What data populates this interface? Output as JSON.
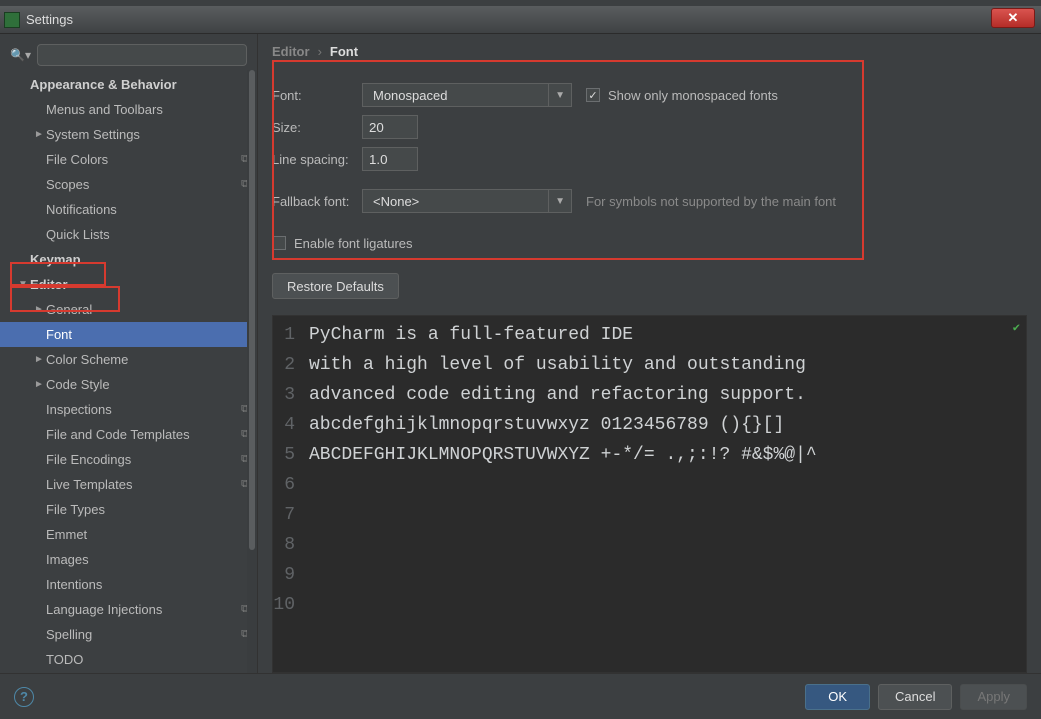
{
  "window": {
    "title": "Settings"
  },
  "breadcrumb": {
    "root": "Editor",
    "current": "Font"
  },
  "sidebar": {
    "search_placeholder": "",
    "items": [
      {
        "label": "Appearance & Behavior",
        "indent": 0,
        "bold": true,
        "arrow": ""
      },
      {
        "label": "Menus and Toolbars",
        "indent": 1,
        "arrow": ""
      },
      {
        "label": "System Settings",
        "indent": 1,
        "arrow": "►"
      },
      {
        "label": "File Colors",
        "indent": 1,
        "arrow": "",
        "copy": true
      },
      {
        "label": "Scopes",
        "indent": 1,
        "arrow": "",
        "copy": true
      },
      {
        "label": "Notifications",
        "indent": 1,
        "arrow": ""
      },
      {
        "label": "Quick Lists",
        "indent": 1,
        "arrow": ""
      },
      {
        "label": "Keymap",
        "indent": 0,
        "bold": true,
        "arrow": ""
      },
      {
        "label": "Editor",
        "indent": 0,
        "bold": true,
        "arrow": "▼"
      },
      {
        "label": "General",
        "indent": 1,
        "arrow": "►"
      },
      {
        "label": "Font",
        "indent": 1,
        "arrow": "",
        "selected": true
      },
      {
        "label": "Color Scheme",
        "indent": 1,
        "arrow": "►"
      },
      {
        "label": "Code Style",
        "indent": 1,
        "arrow": "►"
      },
      {
        "label": "Inspections",
        "indent": 1,
        "arrow": "",
        "copy": true
      },
      {
        "label": "File and Code Templates",
        "indent": 1,
        "arrow": "",
        "copy": true
      },
      {
        "label": "File Encodings",
        "indent": 1,
        "arrow": "",
        "copy": true
      },
      {
        "label": "Live Templates",
        "indent": 1,
        "arrow": "",
        "copy": true
      },
      {
        "label": "File Types",
        "indent": 1,
        "arrow": ""
      },
      {
        "label": "Emmet",
        "indent": 1,
        "arrow": ""
      },
      {
        "label": "Images",
        "indent": 1,
        "arrow": ""
      },
      {
        "label": "Intentions",
        "indent": 1,
        "arrow": ""
      },
      {
        "label": "Language Injections",
        "indent": 1,
        "arrow": "",
        "copy": true
      },
      {
        "label": "Spelling",
        "indent": 1,
        "arrow": "",
        "copy": true
      },
      {
        "label": "TODO",
        "indent": 1,
        "arrow": ""
      }
    ]
  },
  "form": {
    "font_label": "Font:",
    "font_value": "Monospaced",
    "mono_only_label": "Show only monospaced fonts",
    "mono_only_checked": true,
    "size_label": "Size:",
    "size_value": "20",
    "linespacing_label": "Line spacing:",
    "linespacing_value": "1.0",
    "fallback_label": "Fallback font:",
    "fallback_value": "<None>",
    "fallback_hint": "For symbols not supported by the main font",
    "ligatures_label": "Enable font ligatures",
    "ligatures_checked": false,
    "restore_label": "Restore Defaults"
  },
  "preview": {
    "lines": [
      "PyCharm is a full-featured IDE",
      "with a high level of usability and outstanding",
      "advanced code editing and refactoring support.",
      "",
      "abcdefghijklmnopqrstuvwxyz 0123456789 (){}[]",
      "ABCDEFGHIJKLMNOPQRSTUVWXYZ +-*/= .,;:!? #&$%@|^",
      "",
      "",
      "",
      ""
    ]
  },
  "footer": {
    "ok": "OK",
    "cancel": "Cancel",
    "apply": "Apply"
  }
}
